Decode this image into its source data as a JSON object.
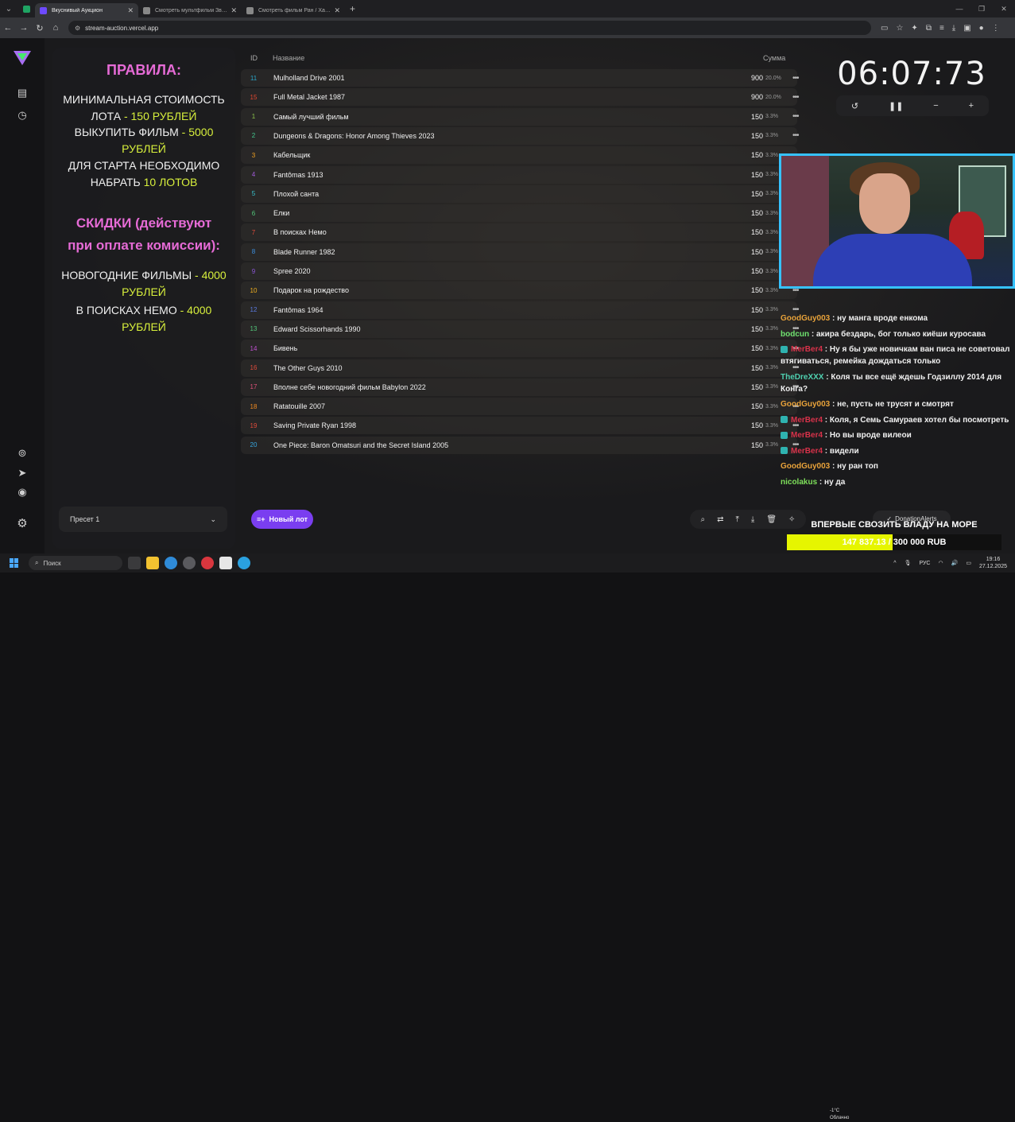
{
  "browser": {
    "tabs": [
      {
        "title": "Вкуснивый Аукцион",
        "active": true,
        "color": "#6d4aff"
      },
      {
        "title": "Смотреть мультфильм Звероп",
        "active": false,
        "color": "#888888"
      },
      {
        "title": "Смотреть фильм Ран / Хаос он",
        "active": false,
        "color": "#888888"
      }
    ],
    "url": "stream-auction.vercel.app"
  },
  "rules": {
    "title": "ПРАВИЛА:",
    "line1": "МИНИМАЛЬНАЯ СТОИМОСТЬ ЛОТА",
    "line1_hl": " - 150 РУБЛЕЙ",
    "line2": "ВЫКУПИТЬ ФИЛЬМ",
    "line2_hl": " - 5000 РУБЛЕЙ",
    "line3": "ДЛЯ СТАРТА НЕОБХОДИМО НАБРАТЬ",
    "line3_hl": " 10 ЛОТОВ",
    "discount_title": "СКИДКИ (действуют при оплате комиссии):",
    "line4": "НОВОГОДНИЕ ФИЛЬМЫ",
    "line4_hl": " - 4000 РУБЛЕЙ",
    "line5": "В ПОИСКАХ НЕМО",
    "line5_hl": " - 4000 РУБЛЕЙ"
  },
  "preset": {
    "label": "Пресет 1"
  },
  "table": {
    "headers": {
      "id": "ID",
      "name": "Название",
      "sum": "Сумма"
    },
    "rows": [
      {
        "id": "11",
        "name": "Mulholland Drive 2001",
        "amount": "900",
        "pct": "20.0%",
        "color": "#2aa7c9"
      },
      {
        "id": "15",
        "name": "Full Metal Jacket 1987",
        "amount": "900",
        "pct": "20.0%",
        "color": "#e2472f"
      },
      {
        "id": "1",
        "name": "Самый лучший фильм",
        "amount": "150",
        "pct": "3.3%",
        "color": "#8bc34a"
      },
      {
        "id": "2",
        "name": "Dungeons & Dragons: Honor Among Thieves 2023",
        "amount": "150",
        "pct": "3.3%",
        "color": "#43c98f"
      },
      {
        "id": "3",
        "name": "Кабельщик",
        "amount": "150",
        "pct": "3.3%",
        "color": "#f0a020"
      },
      {
        "id": "4",
        "name": "Fantômas 1913",
        "amount": "150",
        "pct": "3.3%",
        "color": "#a05ad8"
      },
      {
        "id": "5",
        "name": "Плохой санта",
        "amount": "150",
        "pct": "3.3%",
        "color": "#38c4cf"
      },
      {
        "id": "6",
        "name": "Елки",
        "amount": "150",
        "pct": "3.3%",
        "color": "#52c77a"
      },
      {
        "id": "7",
        "name": "В поисках Немо",
        "amount": "150",
        "pct": "3.3%",
        "color": "#e04b3b"
      },
      {
        "id": "8",
        "name": "Blade Runner 1982",
        "amount": "150",
        "pct": "3.3%",
        "color": "#3b8fe0"
      },
      {
        "id": "9",
        "name": "Spree 2020",
        "amount": "150",
        "pct": "3.3%",
        "color": "#8b55d8"
      },
      {
        "id": "10",
        "name": "Подарок на рождество",
        "amount": "150",
        "pct": "3.3%",
        "color": "#f0b020"
      },
      {
        "id": "12",
        "name": "Fantômas 1964",
        "amount": "150",
        "pct": "3.3%",
        "color": "#5a7be0"
      },
      {
        "id": "13",
        "name": "Edward Scissorhands 1990",
        "amount": "150",
        "pct": "3.3%",
        "color": "#52c77a"
      },
      {
        "id": "14",
        "name": "Бивень",
        "amount": "150",
        "pct": "3.3%",
        "color": "#c050d0"
      },
      {
        "id": "16",
        "name": "The Other Guys 2010",
        "amount": "150",
        "pct": "3.3%",
        "color": "#e04b3b"
      },
      {
        "id": "17",
        "name": "Вполне себе новогодний фильм Babylon 2022",
        "amount": "150",
        "pct": "3.3%",
        "color": "#e0527a"
      },
      {
        "id": "18",
        "name": "Ratatouille 2007",
        "amount": "150",
        "pct": "3.3%",
        "color": "#f08a20"
      },
      {
        "id": "19",
        "name": "Saving Private Ryan 1998",
        "amount": "150",
        "pct": "3.3%",
        "color": "#e04b3b"
      },
      {
        "id": "20",
        "name": "One Piece: Baron Omatsuri and the Secret Island 2005",
        "amount": "150",
        "pct": "3.3%",
        "color": "#38a8e0"
      }
    ]
  },
  "new_lot": {
    "label": "Новый лот"
  },
  "timer": {
    "value": "06:07:73"
  },
  "chat": [
    {
      "user": "GoodGuy003",
      "color": "#e8a23a",
      "badge": false,
      "text": " : ну манга вроде енкома"
    },
    {
      "user": "bodcun",
      "color": "#6fe26f",
      "badge": false,
      "text": " : акира бездарь, бог только киёши куросава"
    },
    {
      "user": "MerBer4",
      "color": "#d8324a",
      "badge": true,
      "text": " : Ну я бы уже новичкам ван писа не советовал втягиваться, ремейка дождаться только"
    },
    {
      "user": "TheDreXXX",
      "color": "#4fd0b0",
      "badge": false,
      "text": " : Коля ты все ещё ждешь Годзиллу 2014 для Конга?"
    },
    {
      "user": "GoodGuy003",
      "color": "#e8a23a",
      "badge": false,
      "text": " : не, пусть не трусят и смотрят"
    },
    {
      "user": "MerBer4",
      "color": "#d8324a",
      "badge": true,
      "text": " : Коля, я Семь Самураев хотел бы посмотреть"
    },
    {
      "user": "MerBer4",
      "color": "#d8324a",
      "badge": true,
      "text": " : Но вы вроде вилеои"
    },
    {
      "user": "MerBer4",
      "color": "#d8324a",
      "badge": true,
      "text": " : видели"
    },
    {
      "user": "GoodGuy003",
      "color": "#e8a23a",
      "badge": false,
      "text": " : ну ран топ"
    },
    {
      "user": "nicolakus",
      "color": "#7ee05a",
      "badge": false,
      "text": " : ну да"
    }
  ],
  "donation": {
    "service": "DonationAlerts",
    "goal_title": "ВПЕРВЫЕ СВОЗИТЬ ВЛАДУ НА МОРЕ",
    "goal_text": "147 837.13 / 300 000 RUB",
    "goal_fraction": 0.4928
  },
  "taskbar": {
    "search": "Поиск",
    "weather_temp": "-1°C",
    "weather_desc": "Облачно",
    "lang": "РУС",
    "time": "19:16",
    "date": "27.12.2025"
  }
}
